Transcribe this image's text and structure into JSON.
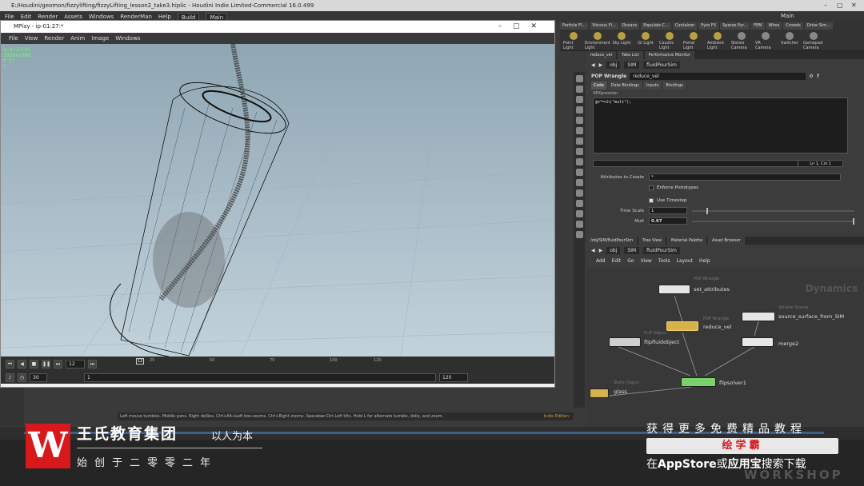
{
  "houdini": {
    "title": "E:/Houdini/geomon/fizzylifting/fizzyLifting_lesson2_take3.hiplic - Houdini Indie Limited-Commercial 16.0.499",
    "menu": [
      "File",
      "Edit",
      "Render",
      "Assets",
      "Windows",
      "RenderMan",
      "Help"
    ],
    "build_label": "Build",
    "main_label": "Main",
    "desk_label": "Main"
  },
  "shelf": {
    "tabs": [
      "Particle Fl...",
      "Viscous Fl...",
      "Oceans",
      "Populate C...",
      "Container",
      "Pyro FX",
      "Sparse Pyr...",
      "FEM",
      "Wires",
      "Crowds",
      "Drive Sim..."
    ],
    "tools": [
      "Point Light",
      "Environment Light",
      "Sky Light",
      "GI Light",
      "Caustic Light",
      "Portal Light",
      "Ambient Light",
      "Stereo Camera",
      "VR Camera",
      "Switcher",
      "Gamepad Camera"
    ]
  },
  "mplay": {
    "title": "MPlay - ip-01:27:*",
    "menu": [
      "File",
      "View",
      "Render",
      "Anim",
      "Image",
      "Windows"
    ],
    "info_lines": [
      "ip-01:27:05",
      "1920x1080",
      "fr 13",
      "C"
    ],
    "frame": "12",
    "ruler_ticks": [
      "12",
      "25",
      "50",
      "75",
      "100",
      "120"
    ],
    "start_frame": "1",
    "end_frame": "120",
    "fps": "30"
  },
  "params": {
    "tabs": [
      "reduce_vel",
      "Take List",
      "Performance Monitor"
    ],
    "path": [
      "obj",
      "SIM",
      "fluidPourSim"
    ],
    "node_type": "POP Wrangle",
    "node_name": "reduce_vel",
    "code_tabs": [
      "Code",
      "Data Bindings",
      "Inputs",
      "Bindings"
    ],
    "vex_label": "VEXpression",
    "vex_code": "@v*=ch(\"mult\");",
    "lncol": "Ln 1, Col 1",
    "attributes_label": "Attributes to Create",
    "attributes_value": "*",
    "enforce_label": "Enforce Prototypes",
    "use_timestep_label": "Use Timestep",
    "time_scale_label": "Time Scale",
    "time_scale_value": "1",
    "mult_label": "Mult",
    "mult_value": "0.97"
  },
  "network": {
    "tabs": [
      "/obj/SIM/fluidPourSim",
      "Tree View",
      "Material Palette",
      "Asset Browser"
    ],
    "path": [
      "obj",
      "SIM",
      "fluidPourSim"
    ],
    "menu": [
      "Add",
      "Edit",
      "Go",
      "View",
      "Tools",
      "Layout",
      "Help"
    ],
    "context_label": "Dynamics",
    "nodes": [
      {
        "type": "POP Wrangle",
        "name": "set_attributes"
      },
      {
        "type": "POP Wrangle",
        "name": "reduce_vel"
      },
      {
        "type": "Volume Source",
        "name": "source_surface_from_SIM"
      },
      {
        "type": "FLIP Object",
        "name": "flipfluidobject"
      },
      {
        "type": "",
        "name": "merge2"
      },
      {
        "type": "",
        "name": "flipsolver1"
      },
      {
        "type": "Static Object",
        "name": "glass"
      }
    ]
  },
  "status": {
    "text": "Left mouse tumbles. Middle pans. Right dollies. Ctrl+Alt+Left box-zooms. Ctrl+Right zooms. Spacebar-Ctrl-Left tilts. Hold L for alternate tumble, dolly, and zoom.",
    "edition": "Indie Edition"
  },
  "overlay": {
    "brand": "王氏教育集团",
    "tagline": "以人为本",
    "founded": "始创于二零零二年",
    "promo_line1": "获得更多免费精品教程",
    "promo_line2": "绘学霸",
    "promo_line3_a": "在",
    "promo_line3_b": "AppStore",
    "promo_line3_c": "或",
    "promo_line3_d": "应用宝",
    "promo_line3_e": "搜索下载",
    "watermark": "WORKSHOP"
  },
  "colors": {
    "logo_red": "#d7191c",
    "node_yellow": "#d6b34a",
    "node_green": "#7bd16a",
    "wrangle_pink": "#d86ad6"
  }
}
